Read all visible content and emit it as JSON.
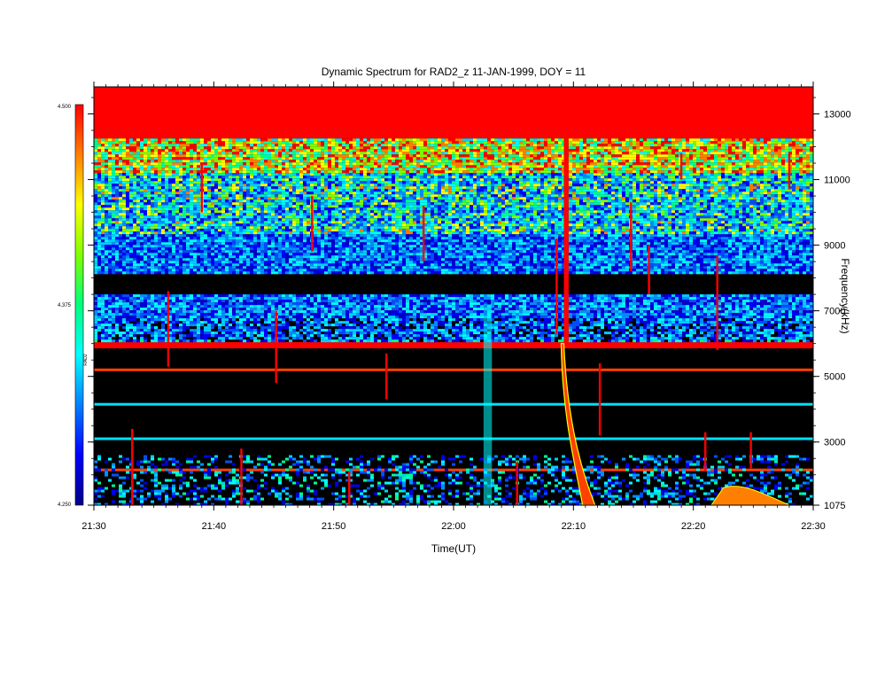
{
  "chart_data": {
    "type": "heatmap",
    "title": "Dynamic Spectrum for RAD2_z 11-JAN-1999, DOY = 11",
    "xlabel": "Time(UT)",
    "ylabel": "Frequency(kHz)",
    "x_ticks": [
      "21:30",
      "21:40",
      "21:50",
      "22:00",
      "22:10",
      "22:20",
      "22:30"
    ],
    "x_range_minutes": [
      0,
      60
    ],
    "y_ticks": [
      13000,
      11000,
      9000,
      7000,
      5000,
      3000,
      1075
    ],
    "y_range_khz": [
      1075,
      13825
    ],
    "colorbar": {
      "label": "RAD2",
      "ticks": [
        "4.500",
        "4.375",
        "4.250"
      ],
      "range": [
        4.25,
        4.5
      ],
      "colors": [
        "#00008b",
        "#0000ff",
        "#0080ff",
        "#00ffff",
        "#00ff80",
        "#80ff00",
        "#ffff00",
        "#ff8000",
        "#ff0000"
      ]
    },
    "features": {
      "saturated_top_khz": 12250,
      "bright_bands_khz": [
        11850,
        11450,
        10750,
        9950,
        9700,
        7350,
        7050,
        5950,
        5200,
        4150,
        3100,
        2150
      ],
      "noise_ranges_khz": [
        [
          8150,
          12250
        ],
        [
          6050,
          7500
        ],
        [
          1075,
          2600
        ]
      ],
      "spikes": [
        {
          "t": 3.2,
          "f0": 1075,
          "f1": 3400
        },
        {
          "t": 6.2,
          "f0": 5300,
          "f1": 7600
        },
        {
          "t": 9.0,
          "f0": 10000,
          "f1": 11500
        },
        {
          "t": 12.3,
          "f0": 1075,
          "f1": 2800
        },
        {
          "t": 15.2,
          "f0": 4800,
          "f1": 7000
        },
        {
          "t": 18.2,
          "f0": 8800,
          "f1": 10500
        },
        {
          "t": 21.3,
          "f0": 1075,
          "f1": 2100
        },
        {
          "t": 24.4,
          "f0": 4300,
          "f1": 5700
        },
        {
          "t": 27.5,
          "f0": 8500,
          "f1": 10200
        },
        {
          "t": 35.3,
          "f0": 1075,
          "f1": 2400
        },
        {
          "t": 38.6,
          "f0": 6300,
          "f1": 9200
        },
        {
          "t": 42.2,
          "f0": 3200,
          "f1": 5400
        },
        {
          "t": 44.8,
          "f0": 8200,
          "f1": 10300
        },
        {
          "t": 46.3,
          "f0": 7500,
          "f1": 9000
        },
        {
          "t": 49.0,
          "f0": 11000,
          "f1": 11800
        },
        {
          "t": 51.0,
          "f0": 2100,
          "f1": 3300
        },
        {
          "t": 52.0,
          "f0": 5800,
          "f1": 8700
        },
        {
          "t": 54.8,
          "f0": 2200,
          "f1": 3300
        },
        {
          "t": 58.0,
          "f0": 10700,
          "f1": 11800
        }
      ],
      "type3_burst": {
        "t0": 39.2,
        "t1": 39.6,
        "f_top": 13000,
        "f_bottom": 1075,
        "drift_t": 41.8
      }
    }
  }
}
